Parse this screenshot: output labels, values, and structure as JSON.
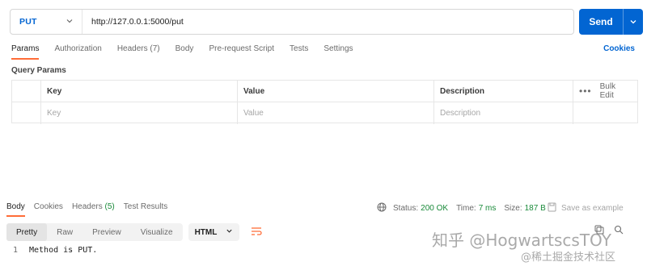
{
  "request": {
    "method": "PUT",
    "url": "http://127.0.0.1:5000/put",
    "send_label": "Send"
  },
  "request_tabs": [
    {
      "label": "Params",
      "active": true
    },
    {
      "label": "Authorization"
    },
    {
      "label": "Headers (7)"
    },
    {
      "label": "Body"
    },
    {
      "label": "Pre-request Script"
    },
    {
      "label": "Tests"
    },
    {
      "label": "Settings"
    }
  ],
  "cookies_label": "Cookies",
  "query_params": {
    "title": "Query Params",
    "headers": {
      "key": "Key",
      "value": "Value",
      "description": "Description",
      "bulk_edit": "Bulk Edit"
    },
    "placeholders": {
      "key": "Key",
      "value": "Value",
      "description": "Description"
    }
  },
  "response_tabs": {
    "body": "Body",
    "cookies": "Cookies",
    "headers": "Headers",
    "headers_count": "(5)",
    "test_results": "Test Results"
  },
  "response_status": {
    "status_label": "Status:",
    "status_value": "200 OK",
    "time_label": "Time:",
    "time_value": "7 ms",
    "size_label": "Size:",
    "size_value": "187 B",
    "save_example": "Save as example"
  },
  "format": {
    "modes": [
      "Pretty",
      "Raw",
      "Preview",
      "Visualize"
    ],
    "active_mode": "Pretty",
    "language": "HTML"
  },
  "response_body": {
    "line_number": "1",
    "text": "Method is PUT."
  },
  "watermark": {
    "line1": "知乎 @HogwartscsTOY",
    "line2": "@稀土掘金技术社区"
  },
  "colors": {
    "accent": "#0265d2",
    "tab_underline": "#ff6c37",
    "success": "#1a8a3a"
  }
}
